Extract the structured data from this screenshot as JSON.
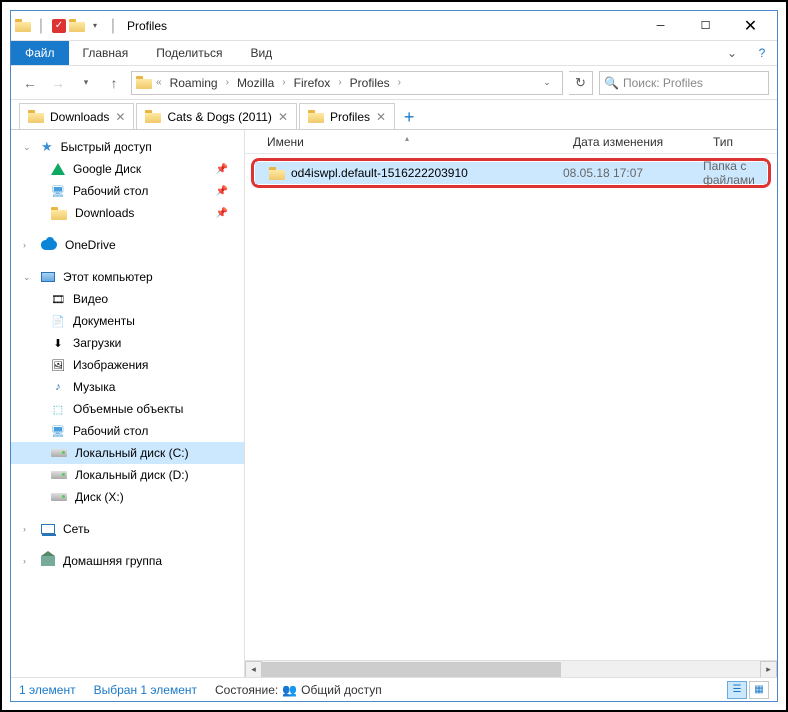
{
  "window": {
    "title": "Profiles"
  },
  "ribbon": {
    "file": "Файл",
    "tabs": [
      "Главная",
      "Поделиться",
      "Вид"
    ]
  },
  "breadcrumb": {
    "items": [
      "Roaming",
      "Mozilla",
      "Firefox",
      "Profiles"
    ]
  },
  "search": {
    "placeholder": "Поиск: Profiles"
  },
  "tabs": [
    {
      "label": "Downloads",
      "active": false
    },
    {
      "label": "Cats & Dogs (2011)",
      "active": false
    },
    {
      "label": "Profiles",
      "active": true
    }
  ],
  "columns": {
    "name": "Имени",
    "date": "Дата изменения",
    "type": "Тип"
  },
  "sidebar": {
    "quick_access": "Быстрый доступ",
    "quick_items": [
      "Google Диск",
      "Рабочий стол",
      "Downloads"
    ],
    "onedrive": "OneDrive",
    "this_pc": "Этот компьютер",
    "pc_items": [
      {
        "label": "Видео",
        "icon": "video"
      },
      {
        "label": "Документы",
        "icon": "doc"
      },
      {
        "label": "Загрузки",
        "icon": "down"
      },
      {
        "label": "Изображения",
        "icon": "img"
      },
      {
        "label": "Музыка",
        "icon": "music"
      },
      {
        "label": "Объемные объекты",
        "icon": "3d"
      },
      {
        "label": "Рабочий стол",
        "icon": "desktop"
      },
      {
        "label": "Локальный диск (C:)",
        "icon": "drive",
        "selected": true
      },
      {
        "label": "Локальный диск (D:)",
        "icon": "drive"
      },
      {
        "label": "Диск (X:)",
        "icon": "drive"
      }
    ],
    "network": "Сеть",
    "homegroup": "Домашняя группа"
  },
  "files": [
    {
      "name": "od4iswpl.default-1516222203910",
      "date": "08.05.18 17:07",
      "type": "Папка с файлами"
    }
  ],
  "statusbar": {
    "count": "1 элемент",
    "selected": "Выбран 1 элемент",
    "state_label": "Состояние:",
    "state_value": "Общий доступ"
  }
}
